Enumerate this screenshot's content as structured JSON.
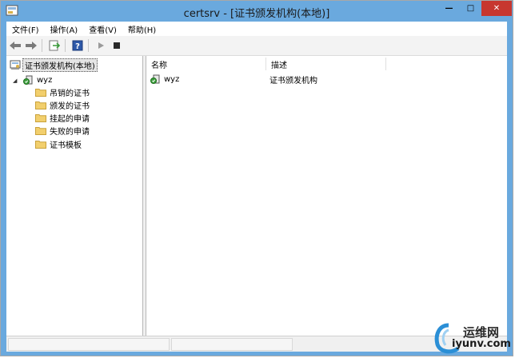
{
  "window": {
    "title": "certsrv - [证书颁发机构(本地)]",
    "buttons": {
      "minimize": "—",
      "maximize": "□",
      "close": "✕"
    }
  },
  "menu": [
    "文件(F)",
    "操作(A)",
    "查看(V)",
    "帮助(H)"
  ],
  "toolbar": {
    "icons": [
      "back-arrow-icon",
      "forward-arrow-icon",
      "export-icon",
      "help-icon",
      "start-service-icon",
      "stop-service-icon"
    ]
  },
  "tree": {
    "root": "证书颁发机构(本地)",
    "ca": {
      "label": "wyz",
      "expander": "◢"
    },
    "children": [
      "吊销的证书",
      "颁发的证书",
      "挂起的申请",
      "失败的申请",
      "证书模板"
    ]
  },
  "list": {
    "columns": [
      "名称",
      "描述"
    ],
    "rows": [
      {
        "name": "wyz",
        "description": "证书颁发机构"
      }
    ]
  },
  "watermark": {
    "line1": "运维网",
    "line2": "iyunv.com"
  },
  "colors": {
    "titlebar": "#6aa9de",
    "close": "#c7372f",
    "folder": "#f2cf6d"
  }
}
